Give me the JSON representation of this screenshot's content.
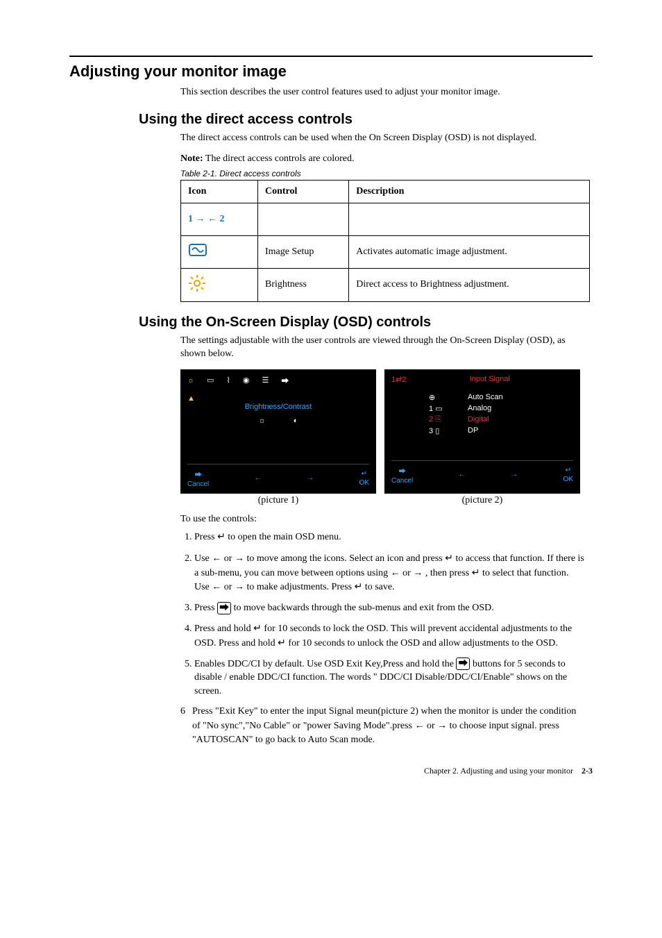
{
  "h1": "Adjusting your monitor image",
  "intro": "This section describes the user control features used to adjust your monitor image.",
  "h2a": "Using the direct access controls",
  "direct_intro": "The direct access controls can be used when the On Screen Display (OSD) is not displayed.",
  "note_label": "Note:",
  "note_text": "The direct access controls are colored.",
  "table_caption": "Table 2-1. Direct access controls",
  "table": {
    "headers": {
      "icon": "Icon",
      "control": "Control",
      "description": "Description"
    },
    "rows": [
      {
        "icon_name": "input-change-icon",
        "control": "",
        "description": ""
      },
      {
        "icon_name": "image-setup-icon",
        "control": "Image Setup",
        "description": "Activates automatic image adjustment."
      },
      {
        "icon_name": "brightness-icon",
        "control": "Brightness",
        "description": "Direct access to Brightness adjustment."
      }
    ]
  },
  "h2b": "Using the On-Screen Display (OSD) controls",
  "osd_intro": "The settings adjustable with the user controls are viewed through the On-Screen Display (OSD), as shown below.",
  "osd1": {
    "title": "Brightness/Contrast",
    "bottom_cancel": "Cancel",
    "bottom_ok": "OK",
    "caption": "(picture 1)"
  },
  "osd2": {
    "title": "Input Signal",
    "items": [
      {
        "idx": "",
        "icon": "⊕",
        "label": "Auto Scan",
        "red": false
      },
      {
        "idx": "1",
        "icon": "▭",
        "label": "Analog",
        "red": false
      },
      {
        "idx": "2",
        "icon": "⎘",
        "label": "Digital",
        "red": true
      },
      {
        "idx": "3",
        "icon": "▯",
        "label": "DP",
        "red": false
      }
    ],
    "bottom_cancel": "Cancel",
    "bottom_ok": "OK",
    "caption": "(picture 2)"
  },
  "to_use": "To use the controls:",
  "steps": {
    "s1a": "Press ",
    "s1b": " to open the main OSD menu.",
    "s2a": "Use ",
    "s2b": " or ",
    "s2c": " to move among the icons. Select an icon and press ",
    "s2d": " to access that function. If there is a sub-menu, you can move between options using ",
    "s2e": " or ",
    "s2f": " , then press ",
    "s2g": " to select that function. Use ",
    "s2h": " or ",
    "s2i": " to make adjustments. Press ",
    "s2j": " to save.",
    "s3a": "Press ",
    "s3b": " to move backwards through the sub-menus and exit from the OSD.",
    "s4a": "Press and hold ",
    "s4b": " for 10 seconds to lock the OSD. This will prevent accidental adjustments to the OSD. Press and hold ",
    "s4c": " for 10 seconds to unlock the OSD and allow adjustments to the OSD.",
    "s5a": "Enables DDC/CI by default. Use OSD Exit Key,Press and hold the ",
    "s5b": " buttons for 5 seconds to disable / enable DDC/CI function. The words \" DDC/CI Disable/DDC/CI/Enable\" shows on the screen.",
    "s6num": "6",
    "s6a": "Press \"Exit Key\" to enter the input Signal meun(picture 2) when the monitor is under the condition of \"No sync\",\"No Cable\" or \"power Saving Mode\".press ",
    "s6b": " or ",
    "s6c": " to choose input signal. press \"AUTOSCAN\" to go back to Auto Scan mode."
  },
  "glyphs": {
    "enter": "↵",
    "left": "←",
    "right": "→",
    "exit": "⎋",
    "exit_box": "⮕"
  },
  "footer": {
    "chapter": "Chapter 2. Adjusting and using your monitor",
    "page": "2-3"
  }
}
